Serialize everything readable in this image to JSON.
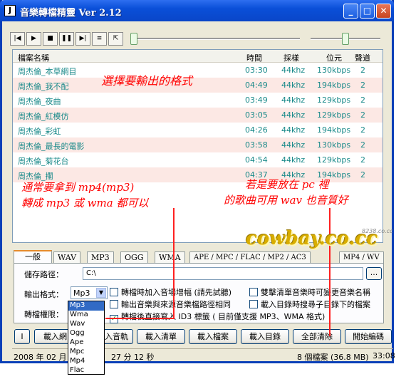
{
  "window": {
    "title": "音樂轉檔精靈 Ver 2.12",
    "minimize": "_",
    "maximize": "□",
    "close": "✕",
    "app_icon": "J"
  },
  "toolbar": {
    "buttons": [
      "|◀",
      "▶",
      "■",
      "❚❚",
      "▶|",
      "≡",
      "⇱"
    ],
    "position_value": 0.0,
    "volume_value": 0.5
  },
  "list": {
    "headers": {
      "name": "檔案名稱",
      "time": "時間",
      "rate": "採樣",
      "bitrate": "位元",
      "channels": "聲道"
    },
    "rows": [
      {
        "name": "周杰倫_本草綱目",
        "time": "03:30",
        "rate": "44khz",
        "bitrate": "130kbps",
        "channels": "2"
      },
      {
        "name": "周杰倫_我不配",
        "time": "04:49",
        "rate": "44khz",
        "bitrate": "194kbps",
        "channels": "2"
      },
      {
        "name": "周杰倫_夜曲",
        "time": "03:49",
        "rate": "44khz",
        "bitrate": "129kbps",
        "channels": "2"
      },
      {
        "name": "周杰倫_紅模仿",
        "time": "03:05",
        "rate": "44khz",
        "bitrate": "129kbps",
        "channels": "2"
      },
      {
        "name": "周杰倫_彩虹",
        "time": "04:26",
        "rate": "44khz",
        "bitrate": "194kbps",
        "channels": "2"
      },
      {
        "name": "周杰倫_最長的電影",
        "time": "03:58",
        "rate": "44khz",
        "bitrate": "130kbps",
        "channels": "2"
      },
      {
        "name": "周杰倫_菊花台",
        "time": "04:54",
        "rate": "44khz",
        "bitrate": "129kbps",
        "channels": "2"
      },
      {
        "name": "周杰倫_擱",
        "time": "04:37",
        "rate": "44khz",
        "bitrate": "194kbps",
        "channels": "2"
      }
    ]
  },
  "tabs": [
    "一般",
    "WAV",
    "MP3",
    "OGG",
    "WMA",
    "APE / MPC / FLAC / MP2 / AC3",
    "MP4 / WV"
  ],
  "settings": {
    "save_path_label": "儲存路徑：",
    "save_path": "C:\\",
    "browse": "...",
    "format_label": "輸出格式：",
    "format_value": "Mp3",
    "limit_label": "轉檔權限：",
    "format_options": [
      "Mp3",
      "Wma",
      "Wav",
      "Ogg",
      "Ape",
      "Mpc",
      "Mp4",
      "Flac"
    ],
    "checks": [
      {
        "label": "轉檔時加入音場增幅 (請先試聽)",
        "checked": false
      },
      {
        "label": "雙擊清單音樂時可變更音樂名稱",
        "checked": false
      },
      {
        "label": "輸出音樂與來源音樂檔路徑相同",
        "checked": false
      },
      {
        "label": "載入目錄時搜尋子目錄下的檔案",
        "checked": false
      },
      {
        "label": "轉檔後直接寫入 ID3 標籤 ( 目前僅支援 MP3、WMA 格式)",
        "checked": true
      }
    ],
    "check_mark": "✓"
  },
  "buttons": [
    "I",
    "載入網",
    "入音軌",
    "載入清單",
    "載入檔案",
    "載入目錄",
    "全部清除",
    "開始編碼"
  ],
  "status": {
    "date": "2008 年 02 月 2",
    "time": "27 分 12 秒",
    "files": "8 個檔案 (36.8 MB)",
    "clock": "33:08"
  },
  "annotations": {
    "select_format": "選擇要輸出的格式",
    "convert_line1": "通常要拿到 mp4(mp3)",
    "convert_line2": "轉成 mp3 或 wma 都可以",
    "pc_line1": "若是要放在 pc 裡",
    "pc_line2": "的歌曲可用 wav 也音質好",
    "brand": "cowbay.co.cc",
    "watermark": "8238.co.cc",
    "colors": {
      "annotation": "#ff0000",
      "brand": "#d8ad00",
      "title_bar": "#0a4fd8"
    }
  }
}
